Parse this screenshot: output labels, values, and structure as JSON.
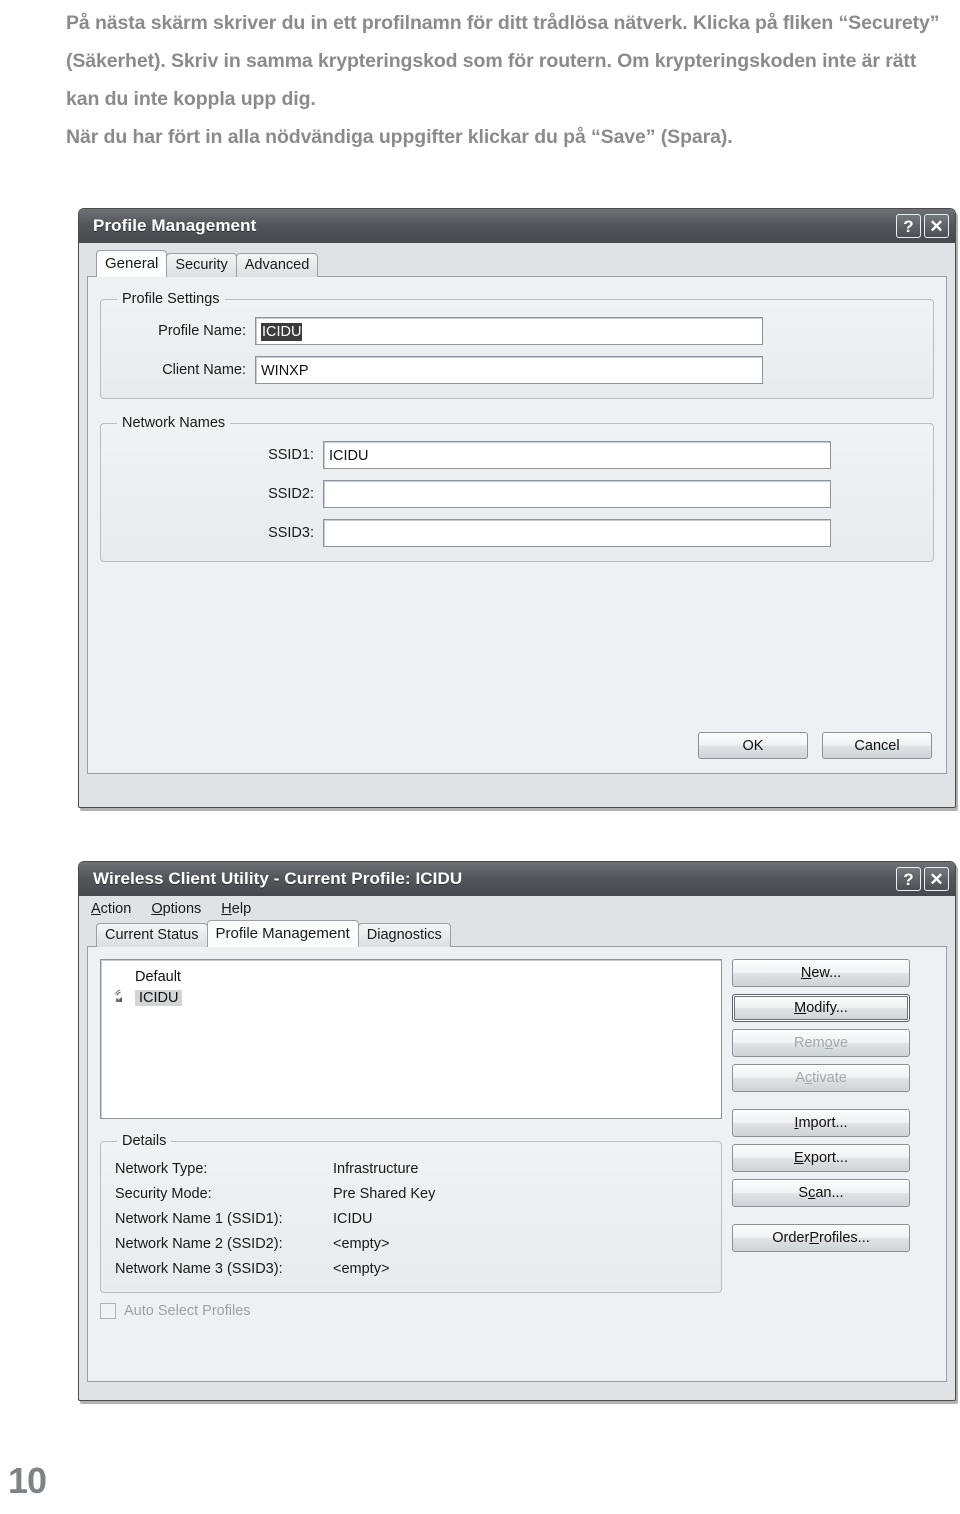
{
  "intro": {
    "lines": [
      "På nästa skärm skriver du in ett profilnamn för ditt trådlösa nätverk. Klicka på fliken “Securety” (Säkerhet). Skriv in samma krypteringskod som för routern. Om krypteringskoden inte är rätt kan du inte koppla upp dig.",
      "När du har fört in alla nödvändiga uppgifter klickar du på “Save” (Spara)."
    ]
  },
  "profile_dialog": {
    "title": "Profile Management",
    "help_button": "?",
    "close_button": "✕",
    "tabs": [
      {
        "label": "General",
        "active": true
      },
      {
        "label": "Security",
        "active": false
      },
      {
        "label": "Advanced",
        "active": false
      }
    ],
    "profile_settings": {
      "legend": "Profile Settings",
      "profile_name_label": "Profile Name:",
      "profile_name_value": "ICIDU",
      "client_name_label": "Client Name:",
      "client_name_value": "WINXP"
    },
    "network_names": {
      "legend": "Network Names",
      "ssid1_label": "SSID1:",
      "ssid1_value": "ICIDU",
      "ssid2_label": "SSID2:",
      "ssid2_value": "",
      "ssid3_label": "SSID3:",
      "ssid3_value": ""
    },
    "ok_label": "OK",
    "cancel_label": "Cancel"
  },
  "wcu_dialog": {
    "title": "Wireless Client Utility - Current Profile: ICIDU",
    "help_button": "?",
    "close_button": "✕",
    "menu": [
      {
        "label": "Action",
        "mnemonic": "A",
        "rest": "ction"
      },
      {
        "label": "Options",
        "mnemonic": "O",
        "rest": "ptions"
      },
      {
        "label": "Help",
        "mnemonic": "H",
        "rest": "elp"
      }
    ],
    "tabs": [
      {
        "label": "Current Status",
        "active": false
      },
      {
        "label": "Profile Management",
        "active": true
      },
      {
        "label": "Diagnostics",
        "active": false
      }
    ],
    "profiles": [
      {
        "name": "Default",
        "selected": false,
        "has_icon": false
      },
      {
        "name": "ICIDU",
        "selected": true,
        "has_icon": true
      }
    ],
    "details": {
      "legend": "Details",
      "rows": [
        {
          "key": "Network Type:",
          "value": "Infrastructure"
        },
        {
          "key": "Security Mode:",
          "value": "Pre Shared Key"
        },
        {
          "key": "Network Name 1 (SSID1):",
          "value": "ICIDU"
        },
        {
          "key": "Network Name 2 (SSID2):",
          "value": "<empty>"
        },
        {
          "key": "Network Name 3 (SSID3):",
          "value": "<empty>"
        }
      ]
    },
    "buttons_upper": [
      {
        "pre": "",
        "mn": "N",
        "post": "ew...",
        "state": "normal"
      },
      {
        "pre": "",
        "mn": "M",
        "post": "odify...",
        "state": "focused"
      },
      {
        "pre": "Rem",
        "mn": "o",
        "post": "ve",
        "state": "disabled"
      },
      {
        "pre": "A",
        "mn": "c",
        "post": "tivate",
        "state": "disabled"
      }
    ],
    "buttons_lower": [
      {
        "pre": "",
        "mn": "I",
        "post": "mport...",
        "state": "normal"
      },
      {
        "pre": "",
        "mn": "E",
        "post": "xport...",
        "state": "normal"
      },
      {
        "pre": "S",
        "mn": "c",
        "post": "an...",
        "state": "normal"
      },
      {
        "pre": "Order ",
        "mn": "P",
        "post": "rofiles...",
        "state": "normal"
      }
    ],
    "auto_select_label": "Auto Select Profiles"
  },
  "footer": {
    "page_number": "10"
  }
}
